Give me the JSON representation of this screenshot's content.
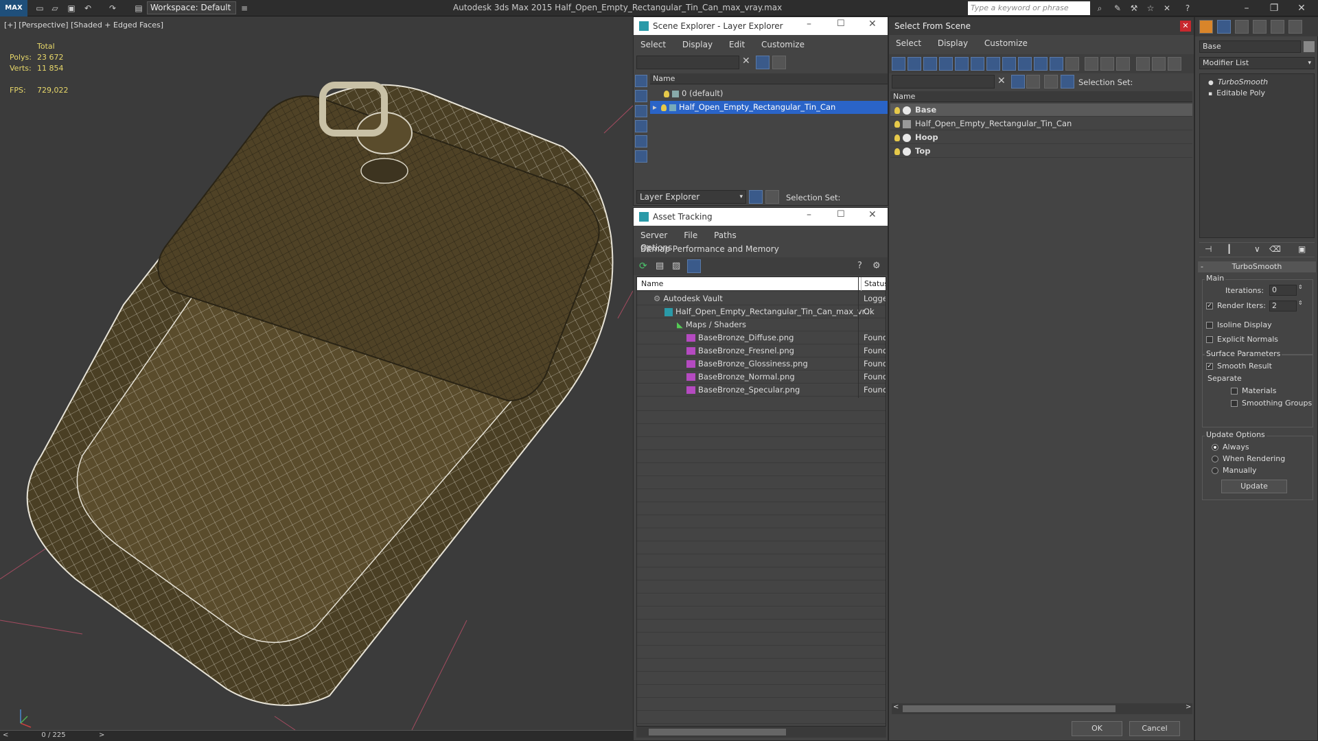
{
  "titlebar": {
    "logo": "MAX",
    "workspace": "Workspace: Default",
    "app_title": "Autodesk 3ds Max  2015    Half_Open_Empty_Rectangular_Tin_Can_max_vray.max",
    "search_placeholder": "Type a keyword or phrase"
  },
  "viewport": {
    "label": "[+] [Perspective] [Shaded + Edged Faces]",
    "stats": {
      "total_label": "Total",
      "polys_label": "Polys:",
      "polys_value": "23 672",
      "verts_label": "Verts:",
      "verts_value": "11 854",
      "fps_label": "FPS:",
      "fps_value": "729,022"
    }
  },
  "timeline": {
    "frame": "0 / 225"
  },
  "scene_explorer": {
    "title": "Scene Explorer - Layer Explorer",
    "menu": [
      "Select",
      "Display",
      "Edit",
      "Customize"
    ],
    "column_name": "Name",
    "rows": [
      "0 (default)",
      "Half_Open_Empty_Rectangular_Tin_Can"
    ],
    "footer_dropdown": "Layer Explorer",
    "footer_selection_set": "Selection Set:"
  },
  "asset_tracking": {
    "title": "Asset Tracking",
    "menu": [
      "Server",
      "File",
      "Paths",
      "Bitmap Performance and Memory"
    ],
    "menu2": "Options",
    "col_name": "Name",
    "col_status": "Status",
    "rows": [
      {
        "name": "Autodesk Vault",
        "status": "Logged"
      },
      {
        "name": "Half_Open_Empty_Rectangular_Tin_Can_max_vr...",
        "status": "Ok"
      },
      {
        "name": "Maps / Shaders",
        "status": ""
      },
      {
        "name": "BaseBronze_Diffuse.png",
        "status": "Found"
      },
      {
        "name": "BaseBronze_Fresnel.png",
        "status": "Found"
      },
      {
        "name": "BaseBronze_Glossiness.png",
        "status": "Found"
      },
      {
        "name": "BaseBronze_Normal.png",
        "status": "Found"
      },
      {
        "name": "BaseBronze_Specular.png",
        "status": "Found"
      }
    ]
  },
  "select_from_scene": {
    "title": "Select From Scene",
    "menu": [
      "Select",
      "Display",
      "Customize"
    ],
    "selection_set": "Selection Set:",
    "column_name": "Name",
    "rows": [
      "Base",
      "Half_Open_Empty_Rectangular_Tin_Can",
      "Hoop",
      "Top"
    ],
    "ok": "OK",
    "cancel": "Cancel"
  },
  "modifier_panel": {
    "object_name": "Base",
    "modifier_list": "Modifier List",
    "stack": [
      "TurboSmooth",
      "Editable Poly"
    ],
    "rollout_title": "TurboSmooth",
    "main_label": "Main",
    "iterations_label": "Iterations:",
    "iterations_value": "0",
    "render_iters_label": "Render Iters:",
    "render_iters_value": "2",
    "isoline_label": "Isoline Display",
    "explicit_normals_label": "Explicit Normals",
    "surface_params_label": "Surface Parameters",
    "smooth_result_label": "Smooth Result",
    "separate_label": "Separate",
    "materials_label": "Materials",
    "smoothing_groups_label": "Smoothing Groups",
    "update_options_label": "Update Options",
    "always_label": "Always",
    "when_rendering_label": "When Rendering",
    "manually_label": "Manually",
    "update_button": "Update"
  }
}
